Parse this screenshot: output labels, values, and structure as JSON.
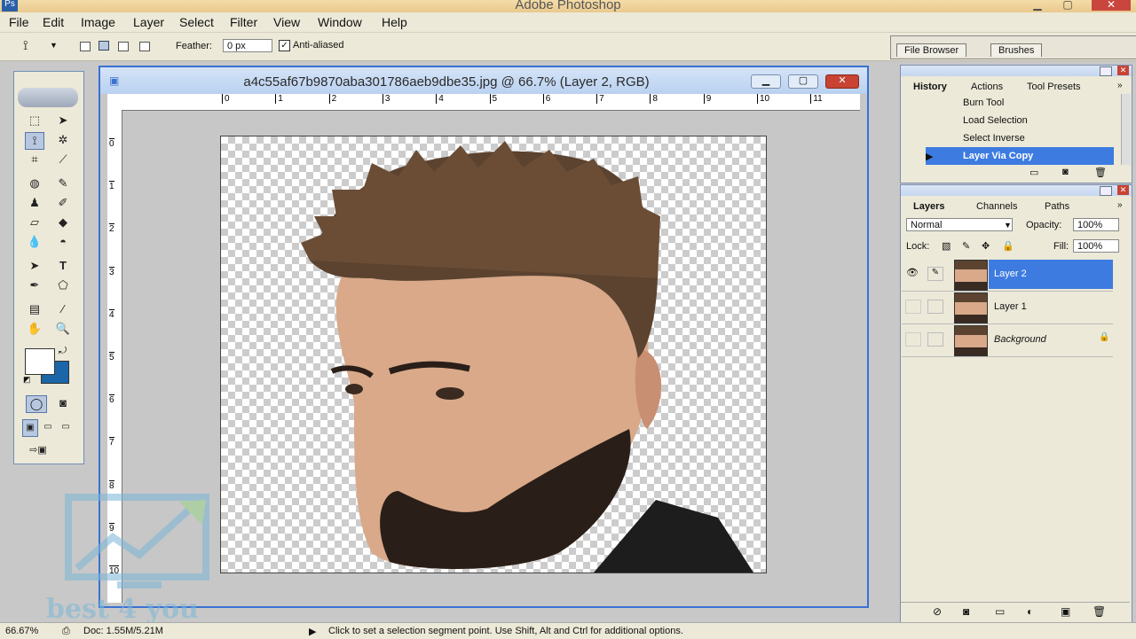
{
  "app": {
    "title": "Adobe Photoshop"
  },
  "menu": [
    "File",
    "Edit",
    "Image",
    "Layer",
    "Select",
    "Filter",
    "View",
    "Window",
    "Help"
  ],
  "options": {
    "feather_label": "Feather:",
    "feather_value": "0 px",
    "antialias_label": "Anti-aliased"
  },
  "palette_well": {
    "tabs": [
      "File Browser",
      "Brushes"
    ]
  },
  "document": {
    "title": "a4c55af67b9870aba301786aeb9dbe35.jpg @ 66.7% (Layer 2, RGB)",
    "hruler": [
      "0",
      "1",
      "2",
      "3",
      "4",
      "5",
      "6",
      "7",
      "8",
      "9",
      "10",
      "11"
    ],
    "vruler": [
      "0",
      "1",
      "2",
      "3",
      "4",
      "5",
      "6",
      "7",
      "8",
      "9",
      "10"
    ]
  },
  "history": {
    "tabs": [
      "History",
      "Actions",
      "Tool Presets"
    ],
    "items": [
      "Burn Tool",
      "Load Selection",
      "Select Inverse",
      "Layer Via Copy"
    ]
  },
  "layers": {
    "tabs": [
      "Layers",
      "Channels",
      "Paths"
    ],
    "blend_mode": "Normal",
    "opacity_label": "Opacity:",
    "opacity_value": "100%",
    "lock_label": "Lock:",
    "fill_label": "Fill:",
    "fill_value": "100%",
    "items": [
      "Layer 2",
      "Layer 1",
      "Background"
    ]
  },
  "status": {
    "zoom": "66.67%",
    "doc": "Doc: 1.55M/5.21M",
    "hint": "Click to set a selection segment point.  Use Shift, Alt and Ctrl for additional options."
  },
  "watermark": {
    "text": "best 4 you"
  },
  "colors": {
    "accent": "#3d7be0",
    "background_swatch": "#1a66a8"
  }
}
